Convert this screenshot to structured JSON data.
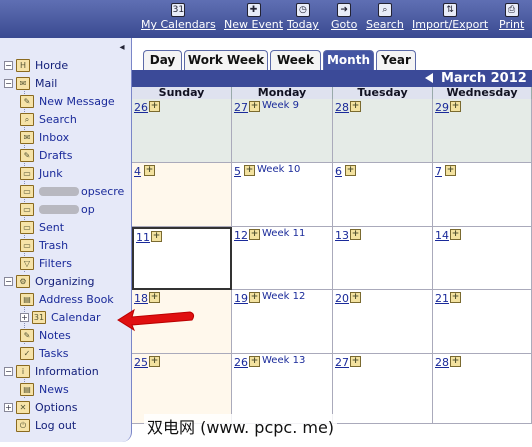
{
  "toolbar": {
    "items": [
      {
        "label": "My Calendars",
        "icon": "calendar-icon"
      },
      {
        "label": "New Event",
        "icon": "new-event-icon"
      },
      {
        "label": "Today",
        "icon": "today-icon"
      },
      {
        "label": "Goto",
        "icon": "goto-icon"
      },
      {
        "label": "Search",
        "icon": "search-icon"
      },
      {
        "label": "Import/Export",
        "icon": "import-export-icon"
      },
      {
        "label": "Print",
        "icon": "print-icon"
      }
    ]
  },
  "sidebar": {
    "items": [
      {
        "label": "Horde",
        "icon": "horde-icon",
        "expander": "−"
      },
      {
        "label": "Mail",
        "icon": "mail-icon",
        "expander": "−"
      },
      {
        "label": "New Message",
        "icon": "new-message-icon"
      },
      {
        "label": "Search",
        "icon": "search-icon"
      },
      {
        "label": "Inbox",
        "icon": "inbox-icon"
      },
      {
        "label": "Drafts",
        "icon": "drafts-icon"
      },
      {
        "label": "Junk",
        "icon": "junk-folder-icon"
      },
      {
        "label": "opsecre",
        "icon": "folder-icon"
      },
      {
        "label": "op",
        "icon": "folder-icon"
      },
      {
        "label": "Sent",
        "icon": "sent-icon"
      },
      {
        "label": "Trash",
        "icon": "trash-icon"
      },
      {
        "label": "Filters",
        "icon": "filter-icon"
      },
      {
        "label": "Organizing",
        "icon": "organizing-icon",
        "expander": "−"
      },
      {
        "label": "Address Book",
        "icon": "address-book-icon"
      },
      {
        "label": "Calendar",
        "icon": "calendar-icon",
        "expander": "+"
      },
      {
        "label": "Notes",
        "icon": "notes-icon"
      },
      {
        "label": "Tasks",
        "icon": "tasks-icon"
      },
      {
        "label": "Information",
        "icon": "information-icon",
        "expander": "−"
      },
      {
        "label": "News",
        "icon": "news-icon"
      },
      {
        "label": "Options",
        "icon": "options-icon",
        "expander": "+"
      },
      {
        "label": "Log out",
        "icon": "logout-icon"
      }
    ]
  },
  "tabs": [
    {
      "label": "Day"
    },
    {
      "label": "Work Week"
    },
    {
      "label": "Week"
    },
    {
      "label": "Month",
      "active": true
    },
    {
      "label": "Year"
    }
  ],
  "calendar": {
    "month_title": "March 2012",
    "weekdays": [
      "Sunday",
      "Monday",
      "Tuesday",
      "Wednesday"
    ],
    "weeks": [
      {
        "label": "Week 9",
        "days": [
          "26",
          "27",
          "28",
          "29"
        ]
      },
      {
        "label": "Week 10",
        "days": [
          "4",
          "5",
          "6",
          "7"
        ]
      },
      {
        "label": "Week 11",
        "days": [
          "11",
          "12",
          "13",
          "14"
        ]
      },
      {
        "label": "Week 12",
        "days": [
          "18",
          "19",
          "20",
          "21"
        ]
      },
      {
        "label": "Week 13",
        "days": [
          "25",
          "26",
          "27",
          "28"
        ]
      }
    ]
  },
  "watermark": "双电网 (www. pcpc. me)",
  "colors": {
    "toolbar": "#4a5aa3",
    "sidebar": "#e6e9f8",
    "month_bar": "#3b4a98",
    "annotation_arrow": "#e01010"
  }
}
